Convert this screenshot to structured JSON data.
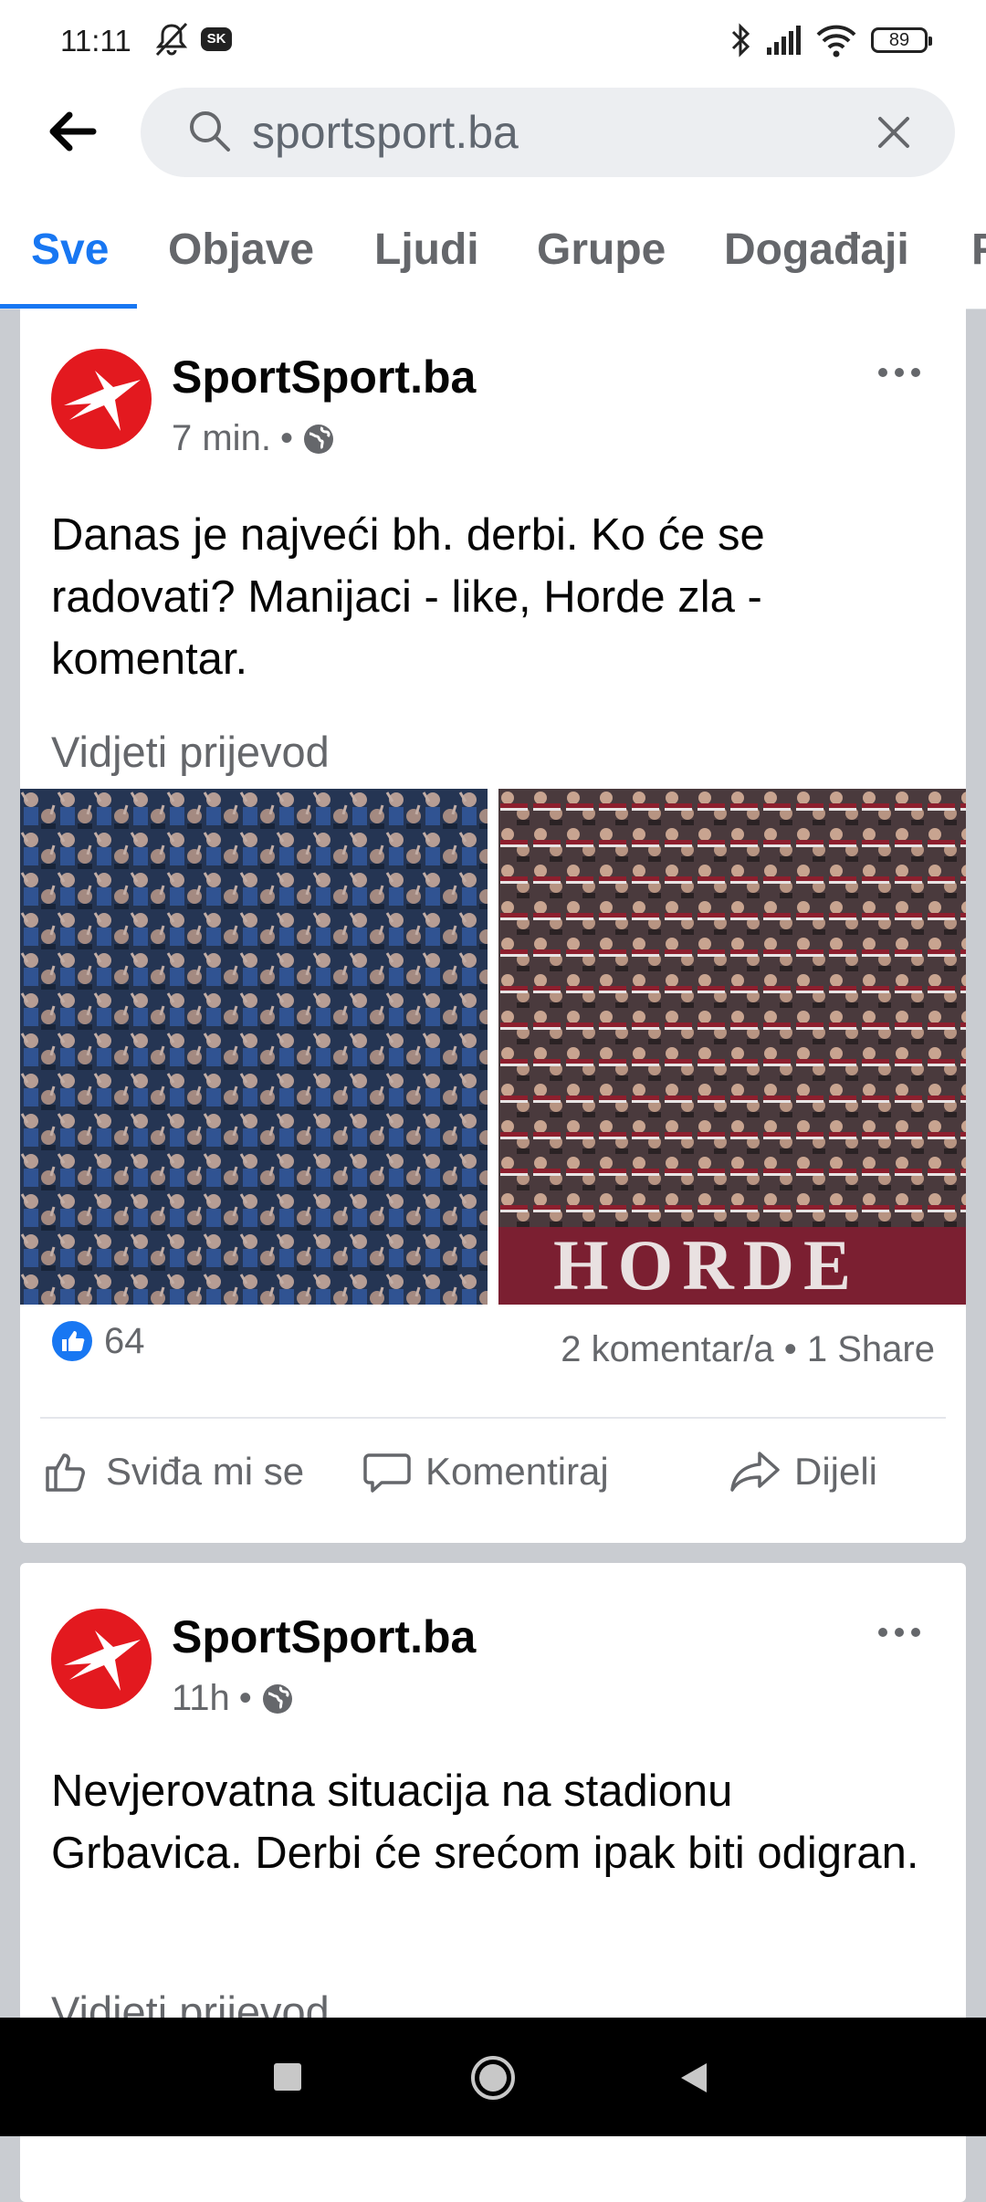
{
  "status_bar": {
    "time": "11:11",
    "carrier_badge": "SK",
    "battery": "89"
  },
  "search": {
    "query": "sportsport.ba"
  },
  "tabs": [
    {
      "label": "Sve",
      "active": true
    },
    {
      "label": "Objave",
      "active": false
    },
    {
      "label": "Ljudi",
      "active": false
    },
    {
      "label": "Grupe",
      "active": false
    },
    {
      "label": "Događaji",
      "active": false
    },
    {
      "label": "F",
      "active": false
    }
  ],
  "posts": [
    {
      "author": "SportSport.ba",
      "time": "7 min.",
      "dot": "•",
      "text": "Danas je najveći bh. derbi. Ko će se radovati? Manijaci - like, Horde zla - komentar.",
      "translate": "Vidjeti prijevod",
      "like_count": "64",
      "stats": "2 komentar/a • 1 Share",
      "actions": {
        "like": "Sviđa mi se",
        "comment": "Komentiraj",
        "share": "Dijeli"
      }
    },
    {
      "author": "SportSport.ba",
      "time": "11h",
      "dot": "•",
      "text": "Nevjerovatna situacija na stadionu Grbavica. Derbi će srećom ipak biti odigran.",
      "translate": "Vidjeti prijevod"
    }
  ],
  "colors": {
    "accent": "#1877f2",
    "logo_red": "#e3191f",
    "secondary_text": "#65676b"
  }
}
